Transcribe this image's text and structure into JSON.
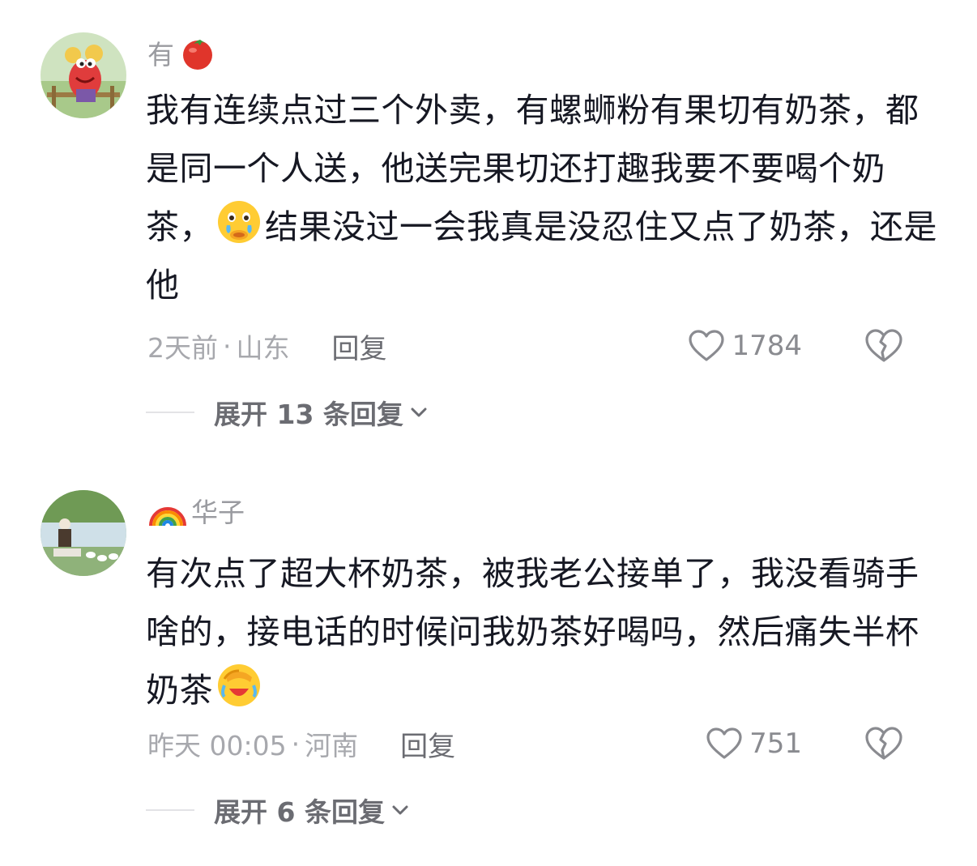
{
  "comments": [
    {
      "username": "有",
      "name_emoji": "tomato",
      "text_parts": [
        "我有连续点过三个外卖，有螺蛳粉有果切有奶茶，都是同一个人送，他送完果切还打趣我要不要喝个奶茶，",
        "结果没过一会我真是没忍住又点了奶茶，还是他"
      ],
      "inline_emoji": "crying-face-emoji",
      "time": "2天前",
      "location": "山东",
      "reply_label": "回复",
      "likes": "1784",
      "expand_label": "展开 13 条回复"
    },
    {
      "username": "华子",
      "name_emoji": "rainbow",
      "text_parts": [
        "有次点了超大杯奶茶，被我老公接单了，我没看骑手啥的，接电话的时候问我奶茶好喝吗，然后痛失半杯奶茶"
      ],
      "inline_emoji": "facepalm-laugh-emoji",
      "time": "昨天 00:05",
      "location": "河南",
      "reply_label": "回复",
      "likes": "751",
      "expand_label": "展开 6 条回复"
    }
  ],
  "separator": "·",
  "colors": {
    "text": "#161823",
    "secondary": "#a7a8ad",
    "action": "#6b6c72"
  }
}
